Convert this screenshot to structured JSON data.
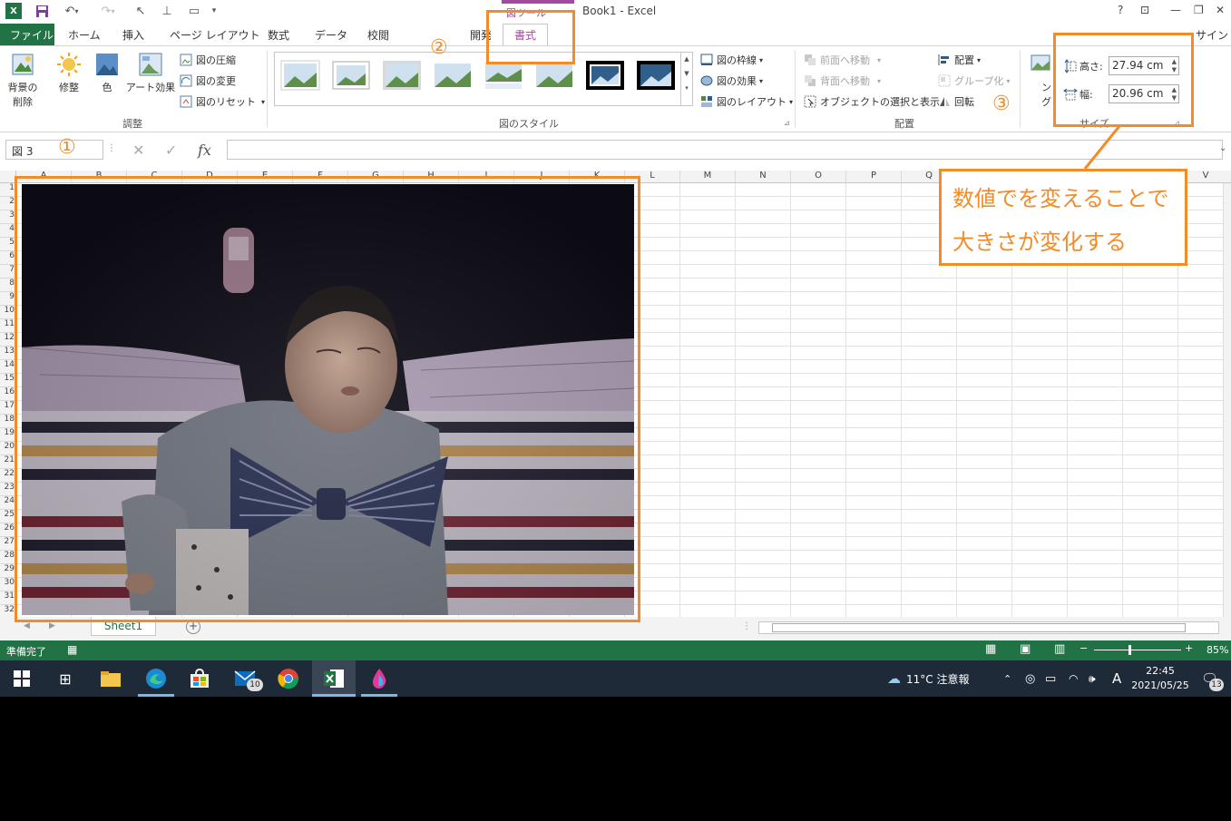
{
  "window": {
    "title": "Book1 - Excel",
    "context_tab_group": "図ツール",
    "help": "?",
    "signin": "サインイ"
  },
  "tabs": {
    "file": "ファイル",
    "items": [
      "ホーム",
      "挿入",
      "ページ レイアウト",
      "数式",
      "データ",
      "校閲",
      "開発"
    ],
    "active": "書式"
  },
  "ribbon": {
    "adjust": {
      "remove_bg": [
        "背景の",
        "削除"
      ],
      "corrections": "修整",
      "color": "色",
      "artistic": "アート効果",
      "compress": "図の圧縮",
      "change": "図の変更",
      "reset": "図のリセット",
      "label": "調整"
    },
    "styles": {
      "border": "図の枠線",
      "effects": "図の効果",
      "layout": "図のレイアウト",
      "label": "図のスタイル"
    },
    "arrange": {
      "bring_forward": "前面へ移動",
      "send_backward": "背面へ移動",
      "selection_pane": "オブジェクトの選択と表示",
      "align": "配置",
      "group": "グループ化",
      "rotate": "回転",
      "label": "配置"
    },
    "crop_partial": "ング",
    "size": {
      "height_label": "高さ:",
      "height_value": "27.94 cm",
      "width_label": "幅:",
      "width_value": "20.96 cm",
      "label": "サイズ"
    }
  },
  "formula_bar": {
    "name_box": "図 3",
    "fx": "fx",
    "value": ""
  },
  "grid": {
    "columns": [
      "A",
      "B",
      "C",
      "D",
      "E",
      "F",
      "G",
      "H",
      "I",
      "J",
      "K",
      "L",
      "M",
      "N",
      "O",
      "P",
      "Q",
      "R",
      "S",
      "T",
      "U",
      "V"
    ],
    "rows": [
      "1",
      "2",
      "3",
      "4",
      "5",
      "6",
      "7",
      "8",
      "9",
      "10",
      "11",
      "12",
      "13",
      "14",
      "15",
      "16",
      "17",
      "18",
      "19",
      "20",
      "21",
      "22",
      "23",
      "24",
      "25",
      "26",
      "27",
      "28",
      "29",
      "30",
      "31",
      "32"
    ]
  },
  "sheet": {
    "tab": "Sheet1",
    "add": "+"
  },
  "status": {
    "ready": "準備完了",
    "zoom": "85%"
  },
  "taskbar": {
    "mail_badge": "10",
    "weather": "11°C 注意報",
    "ime": "A",
    "time": "22:45",
    "date": "2021/05/25",
    "notif_badge": "13"
  },
  "annotations": {
    "n1": "①",
    "n2": "②",
    "n3": "③",
    "callout_line1": "数値でを変えることで",
    "callout_line2": "大きさが変化する"
  }
}
